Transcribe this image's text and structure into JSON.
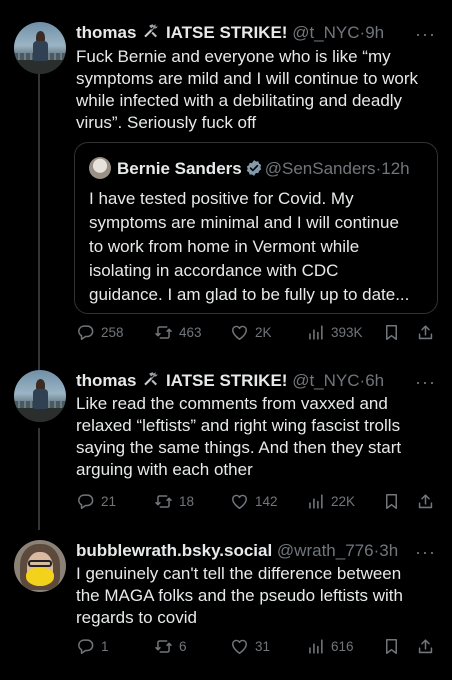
{
  "tweets": [
    {
      "name": "thomas",
      "name_suffix": "IATSE STRIKE!",
      "handle": "@t_NYC",
      "time": "9h",
      "text_lines": [
        "Fuck Bernie and everyone who is like “my",
        "symptoms are mild and I will continue to work",
        "while infected with a debilitating and deadly",
        "virus”. Seriously fuck off"
      ],
      "quote": {
        "name": "Bernie Sanders",
        "handle": "@SenSanders",
        "time": "12h",
        "text_lines": [
          "I have tested positive for Covid. My",
          "symptoms are minimal and I will continue",
          "to work from home in Vermont while",
          "isolating in accordance with CDC",
          "guidance. I am glad to be fully up to date..."
        ]
      },
      "stats": {
        "replies": "258",
        "reposts": "463",
        "likes": "2K",
        "views": "393K"
      }
    },
    {
      "name": "thomas",
      "name_suffix": "IATSE STRIKE!",
      "handle": "@t_NYC",
      "time": "6h",
      "text_lines": [
        "Like read the comments from vaxxed and",
        "relaxed “leftists” and right wing fascist trolls",
        "saying the same things. And then they start",
        "arguing with each other"
      ],
      "stats": {
        "replies": "21",
        "reposts": "18",
        "likes": "142",
        "views": "22K"
      }
    },
    {
      "name": "bubblewrath.bsky.social",
      "handle": "@wrath_776",
      "time": "3h",
      "text_lines": [
        "I genuinely can't tell the difference between",
        "the MAGA folks and the pseudo leftists with",
        "regards to covid"
      ],
      "stats": {
        "replies": "1",
        "reposts": "6",
        "likes": "31",
        "views": "616"
      }
    }
  ],
  "ui": {
    "separator": "·",
    "more": "···"
  },
  "icons": {
    "reply": "reply-icon",
    "repost": "repost-icon",
    "like": "heart-icon",
    "views": "views-icon",
    "bookmark": "bookmark-icon",
    "share": "share-icon",
    "verified": "verified-badge-icon",
    "tools": "hammer-wrench-icon"
  },
  "colors": {
    "background": "#000000",
    "text": "#e7e9ea",
    "muted": "#71767b",
    "border": "#2f3336",
    "verified": "#829aab"
  }
}
